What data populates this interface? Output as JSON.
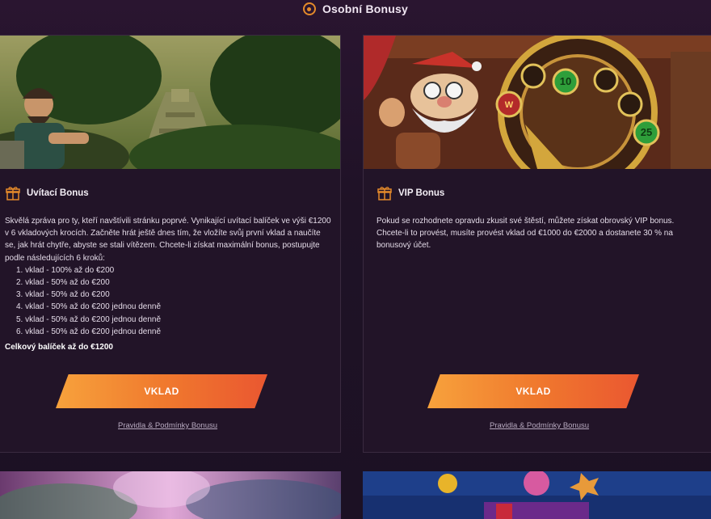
{
  "header": {
    "title": "Osobní Bonusy",
    "icon": "bonus-coin-icon",
    "accent": "#e48a2a"
  },
  "cards": [
    {
      "heading": "Uvítací Bonus",
      "icon": "gift-icon",
      "intro": "Skvělá zpráva pro ty, kteří navštívili stránku poprvé. Vynikající uvítací balíček ve výši €1200 v 6 vkladových krocích. Začněte hrát ještě dnes tím, že vložíte svůj první vklad a naučíte se, jak hrát chytře, abyste se stali vítězem. Chcete-li získat maximální bonus, postupujte podle následujících 6 kroků:",
      "steps": [
        "1. vklad - 100% až do €200",
        "2. vklad - 50% až do €200",
        "3. vklad - 50% až do €200",
        "4. vklad - 50% až do €200 jednou denně",
        "5. vklad - 50% až do €200 jednou denně",
        "6. vklad - 50% až do €200 jednou denně"
      ],
      "total": "Celkový balíček až do €1200",
      "cta": "VKLAD",
      "terms": "Pravidla & Podmínky Bonusu"
    },
    {
      "heading": "VIP Bonus",
      "icon": "gift-icon",
      "intro": "Pokud se rozhodnete opravdu zkusit své štěstí, můžete získat obrovský VIP bonus. Chcete-li to provést, musíte provést vklad od €1000 do €2000 a dostanete 30 % na bonusový účet.",
      "wheel_numbers": [
        "10",
        "25"
      ],
      "wheel_letter": "W",
      "cta": "VKLAD",
      "terms": "Pravidla & Podmínky Bonusu"
    }
  ],
  "colors": {
    "background": "#1f1226",
    "card": "#221428",
    "cta_start": "#f7a23c",
    "cta_end": "#ea5730",
    "gift": "#e48a2a"
  }
}
